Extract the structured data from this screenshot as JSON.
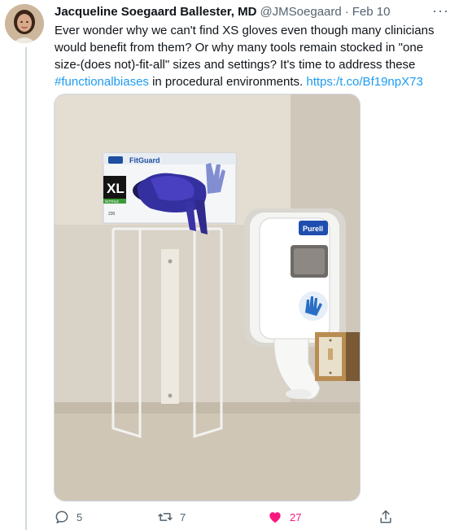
{
  "tweet": {
    "display_name": "Jacqueline Soegaard Ballester, MD",
    "handle": "@JMSoegaard",
    "separator": "·",
    "date": "Feb 10",
    "more_label": "···",
    "text_before": "Ever wonder why we can't find XS gloves even though many clinicians would benefit from them? Or why many tools remain stocked in \"one size-(does not)-fit-all\" sizes and settings? It's time to address these ",
    "hashtag": "#functionalbiases",
    "text_middle": " in procedural environments. ",
    "link": "https:/t.co/Bf19npX73"
  },
  "media": {
    "glove_box_brand": "FitGuard",
    "glove_box_size": "XL",
    "glove_box_sub": "NITRILE",
    "glove_box_count": "230",
    "dispenser_brand": "Purell",
    "wall_color": "#d6cfc3",
    "glove_color": "#2f2a8c"
  },
  "actions": {
    "reply_count": "5",
    "retweet_count": "7",
    "like_count": "27",
    "accent_like": "#f91880",
    "icon_color": "#536471"
  }
}
